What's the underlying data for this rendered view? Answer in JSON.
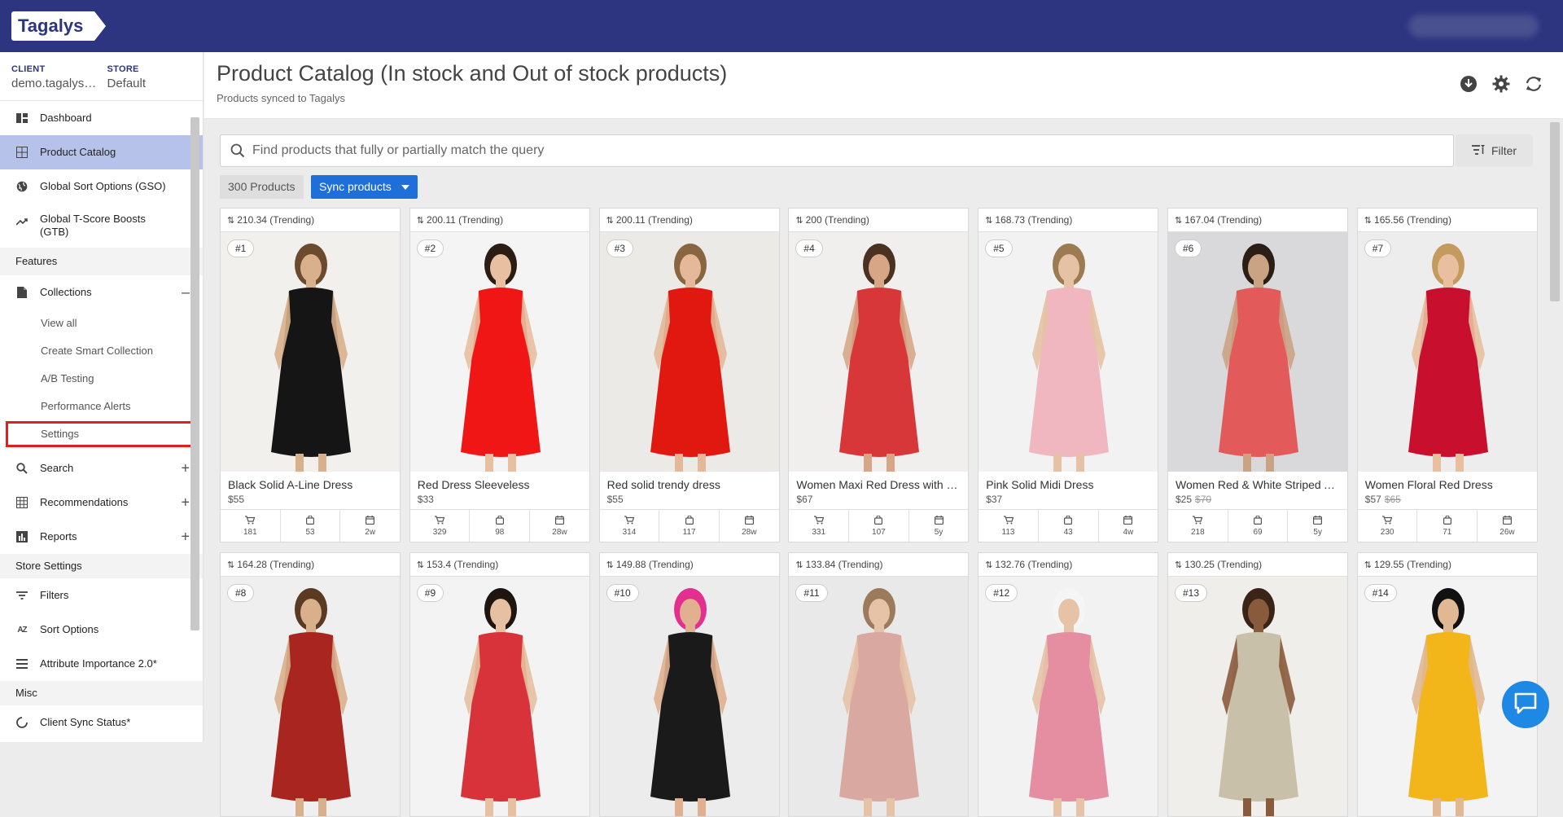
{
  "app": {
    "logo": "Tagalys"
  },
  "sidebar": {
    "client_label": "CLIENT",
    "client_value": "demo.tagalys.com",
    "store_label": "STORE",
    "store_value": "Default",
    "items": [
      {
        "label": "Dashboard",
        "icon": "dashboard-icon"
      },
      {
        "label": "Product Catalog",
        "icon": "grid-icon",
        "active": true
      },
      {
        "label": "Global Sort Options (GSO)",
        "icon": "globe-icon"
      },
      {
        "label": "Global T-Score Boosts (GTB)",
        "icon": "trending-up-icon"
      }
    ],
    "features_label": "Features",
    "collections": {
      "label": "Collections",
      "toggle": "–",
      "sub": [
        "View all",
        "Create Smart Collection",
        "A/B Testing",
        "Performance Alerts",
        "Settings"
      ]
    },
    "features_more": [
      {
        "label": "Search",
        "toggle": "+"
      },
      {
        "label": "Recommendations",
        "toggle": "+"
      },
      {
        "label": "Reports",
        "toggle": "+"
      }
    ],
    "store_settings_label": "Store Settings",
    "store_settings": [
      {
        "label": "Filters"
      },
      {
        "label": "Sort Options"
      },
      {
        "label": "Attribute Importance 2.0*"
      }
    ],
    "misc_label": "Misc",
    "misc": [
      {
        "label": "Client Sync Status*"
      }
    ]
  },
  "header": {
    "title": "Product Catalog (In stock and Out of stock products)",
    "subtitle": "Products synced to Tagalys"
  },
  "search": {
    "placeholder": "Find products that fully or partially match the query"
  },
  "filter_label": "Filter",
  "product_count": "300 Products",
  "sync_label": "Sync products",
  "products": [
    {
      "score": "210.34 (Trending)",
      "rank": "#1",
      "name": "Black Solid A-Line Dress",
      "price": "$55",
      "old_price": "",
      "stats": [
        "181",
        "53",
        "2w"
      ],
      "bg": "#f2f0ed",
      "dress": "#151515",
      "skin": "#d9b08c",
      "hair": "#6b4a2e"
    },
    {
      "score": "200.11 (Trending)",
      "rank": "#2",
      "name": "Red Dress Sleeveless",
      "price": "$33",
      "old_price": "",
      "stats": [
        "329",
        "98",
        "28w"
      ],
      "bg": "#f4f4f4",
      "dress": "#f01616",
      "skin": "#e8bfa0",
      "hair": "#2b1d14"
    },
    {
      "score": "200.11 (Trending)",
      "rank": "#3",
      "name": "Red solid trendy dress",
      "price": "$55",
      "old_price": "",
      "stats": [
        "314",
        "117",
        "28w"
      ],
      "bg": "#ebeae6",
      "dress": "#e0180f",
      "skin": "#e4b898",
      "hair": "#8a6640"
    },
    {
      "score": "200 (Trending)",
      "rank": "#4",
      "name": "Women Maxi Red Dress with Smocking",
      "price": "$67",
      "old_price": "",
      "stats": [
        "331",
        "107",
        "5y"
      ],
      "bg": "#f0efed",
      "dress": "#d8373a",
      "skin": "#d6a686",
      "hair": "#4a3222"
    },
    {
      "score": "168.73 (Trending)",
      "rank": "#5",
      "name": "Pink Solid Midi Dress",
      "price": "$37",
      "old_price": "",
      "stats": [
        "113",
        "43",
        "4w"
      ],
      "bg": "#f2f2f2",
      "dress": "#f0b7c0",
      "skin": "#e6c2a4",
      "hair": "#9c7a52"
    },
    {
      "score": "167.04 (Trending)",
      "rank": "#6",
      "name": "Women Red & White Striped A-Line Dress",
      "price": "$25",
      "old_price": "$70",
      "stats": [
        "218",
        "69",
        "5y"
      ],
      "bg": "#d9d9db",
      "dress": "#e25a5a",
      "skin": "#caa284",
      "hair": "#2a1e16"
    },
    {
      "score": "165.56 (Trending)",
      "rank": "#7",
      "name": "Women Floral Red Dress",
      "price": "$57",
      "old_price": "$65",
      "stats": [
        "230",
        "71",
        "26w"
      ],
      "bg": "#ededed",
      "dress": "#c8102e",
      "skin": "#e8c0a0",
      "hair": "#c49a5e"
    },
    {
      "score": "164.28 (Trending)",
      "rank": "#8",
      "name": "",
      "price": "",
      "old_price": "",
      "stats": [],
      "bg": "#efefef",
      "dress": "#a8261f",
      "skin": "#d9b08c",
      "hair": "#5a3a22"
    },
    {
      "score": "153.4 (Trending)",
      "rank": "#9",
      "name": "",
      "price": "",
      "old_price": "",
      "stats": [],
      "bg": "#f3f3f3",
      "dress": "#d8323a",
      "skin": "#e6c0a0",
      "hair": "#1e1410"
    },
    {
      "score": "149.88 (Trending)",
      "rank": "#10",
      "name": "",
      "price": "",
      "old_price": "",
      "stats": [],
      "bg": "#ececec",
      "dress": "#1a1a1a",
      "skin": "#e0b090",
      "hair": "#e3308f"
    },
    {
      "score": "133.84 (Trending)",
      "rank": "#11",
      "name": "",
      "price": "",
      "old_price": "",
      "stats": [],
      "bg": "#e9e9e9",
      "dress": "#d9a8a0",
      "skin": "#e6c2a6",
      "hair": "#9b7b5c"
    },
    {
      "score": "132.76 (Trending)",
      "rank": "#12",
      "name": "",
      "price": "",
      "old_price": "",
      "stats": [],
      "bg": "#f2f2f2",
      "dress": "#e58ea2",
      "skin": "#e6c2a6",
      "hair": "#f5f5f5"
    },
    {
      "score": "130.25 (Trending)",
      "rank": "#13",
      "name": "",
      "price": "",
      "old_price": "",
      "stats": [],
      "bg": "#f0eeea",
      "dress": "#c8c0a8",
      "skin": "#8a5a3c",
      "hair": "#3a2418"
    },
    {
      "score": "129.55 (Trending)",
      "rank": "#14",
      "name": "",
      "price": "",
      "old_price": "",
      "stats": [],
      "bg": "#f3f3f3",
      "dress": "#f2b51a",
      "skin": "#e0b894",
      "hair": "#111111"
    }
  ],
  "colors": {
    "topbar": "#2d3480",
    "active_nav": "#b6c2ea",
    "sync_button": "#1e6fd9",
    "highlight_box": "#e02020"
  }
}
